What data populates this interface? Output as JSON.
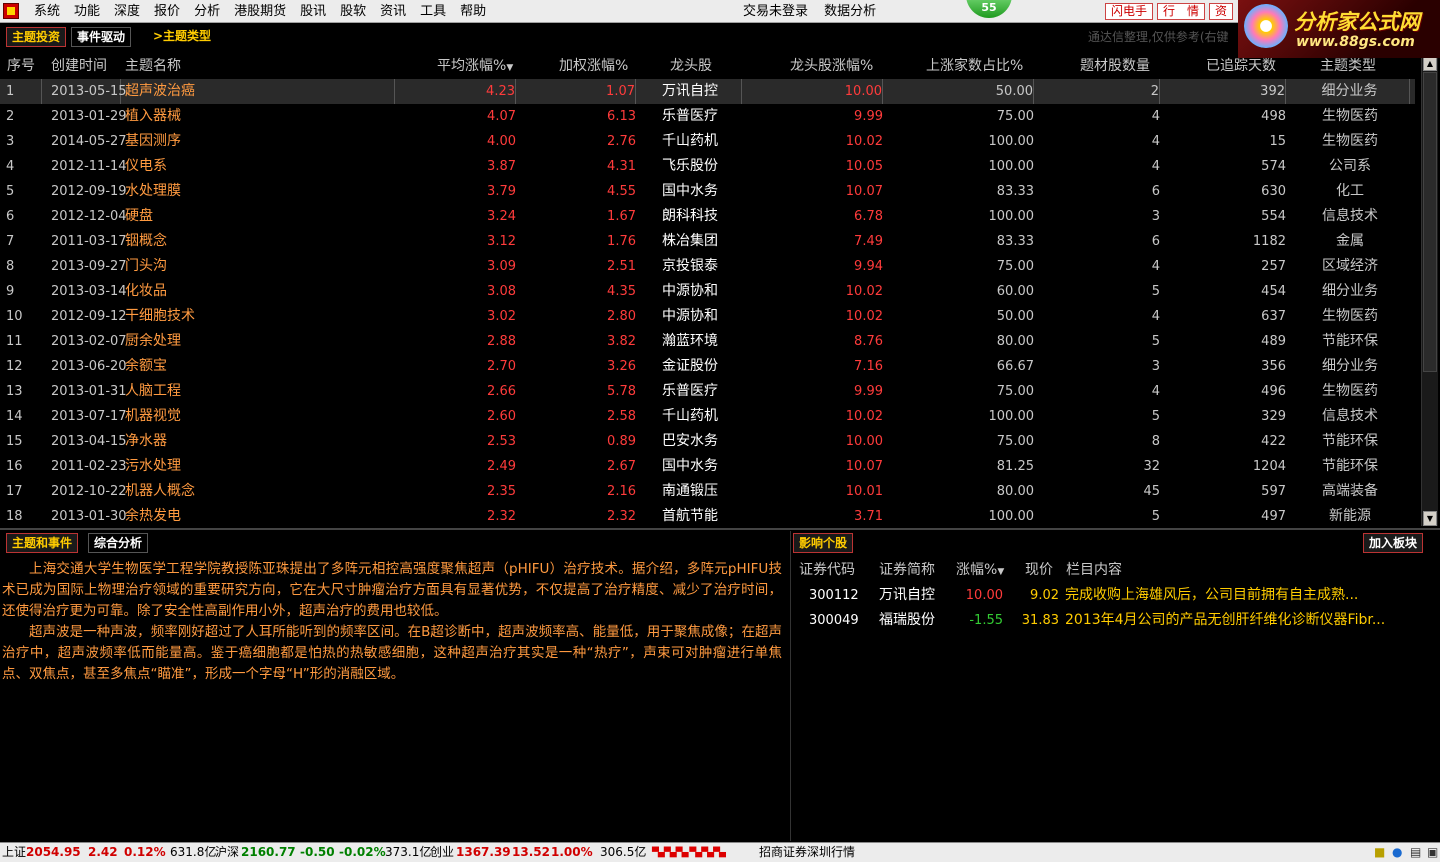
{
  "menu": [
    "系统",
    "功能",
    "深度",
    "报价",
    "分析",
    "港股期货",
    "股讯",
    "股软",
    "资讯",
    "工具",
    "帮助"
  ],
  "menubar": {
    "login": "交易未登录",
    "data": "数据分析",
    "badge": "55",
    "buttons": [
      "闪电手",
      "行　情",
      "资"
    ]
  },
  "brand": {
    "title": "分析家公式网",
    "url": "www.88gs.com"
  },
  "tabs": {
    "theme": "主题投资",
    "event": "事件驱动",
    "type": ">主题类型",
    "hint": "通达信整理,仅供参考(右键"
  },
  "headers": {
    "seq": "序号",
    "date": "创建时间",
    "name": "主题名称",
    "avg": "平均涨幅%",
    "wt": "加权涨幅%",
    "lead": "龙头股",
    "lchg": "龙头股涨幅%",
    "ratio": "上涨家数占比%",
    "cnt": "题材股数量",
    "days": "已追踪天数",
    "type": "主题类型"
  },
  "rows": [
    {
      "seq": "1",
      "date": "2013-05-15",
      "name": "超声波治癌",
      "avg": "4.23",
      "wt": "1.07",
      "lead": "万讯自控",
      "lchg": "10.00",
      "ratio": "50.00",
      "cnt": "2",
      "days": "392",
      "type": "细分业务"
    },
    {
      "seq": "2",
      "date": "2013-01-29",
      "name": "植入器械",
      "avg": "4.07",
      "wt": "6.13",
      "lead": "乐普医疗",
      "lchg": "9.99",
      "ratio": "75.00",
      "cnt": "4",
      "days": "498",
      "type": "生物医药"
    },
    {
      "seq": "3",
      "date": "2014-05-27",
      "name": "基因测序",
      "avg": "4.00",
      "wt": "2.76",
      "lead": "千山药机",
      "lchg": "10.02",
      "ratio": "100.00",
      "cnt": "4",
      "days": "15",
      "type": "生物医药"
    },
    {
      "seq": "4",
      "date": "2012-11-14",
      "name": "仪电系",
      "avg": "3.87",
      "wt": "4.31",
      "lead": "飞乐股份",
      "lchg": "10.05",
      "ratio": "100.00",
      "cnt": "4",
      "days": "574",
      "type": "公司系"
    },
    {
      "seq": "5",
      "date": "2012-09-19",
      "name": "水处理膜",
      "avg": "3.79",
      "wt": "4.55",
      "lead": "国中水务",
      "lchg": "10.07",
      "ratio": "83.33",
      "cnt": "6",
      "days": "630",
      "type": "化工"
    },
    {
      "seq": "6",
      "date": "2012-12-04",
      "name": "硬盘",
      "avg": "3.24",
      "wt": "1.67",
      "lead": "朗科科技",
      "lchg": "6.78",
      "ratio": "100.00",
      "cnt": "3",
      "days": "554",
      "type": "信息技术"
    },
    {
      "seq": "7",
      "date": "2011-03-17",
      "name": "铟概念",
      "avg": "3.12",
      "wt": "1.76",
      "lead": "株冶集团",
      "lchg": "7.49",
      "ratio": "83.33",
      "cnt": "6",
      "days": "1182",
      "type": "金属"
    },
    {
      "seq": "8",
      "date": "2013-09-27",
      "name": "门头沟",
      "avg": "3.09",
      "wt": "2.51",
      "lead": "京投银泰",
      "lchg": "9.94",
      "ratio": "75.00",
      "cnt": "4",
      "days": "257",
      "type": "区域经济"
    },
    {
      "seq": "9",
      "date": "2013-03-14",
      "name": "化妆品",
      "avg": "3.08",
      "wt": "4.35",
      "lead": "中源协和",
      "lchg": "10.02",
      "ratio": "60.00",
      "cnt": "5",
      "days": "454",
      "type": "细分业务"
    },
    {
      "seq": "10",
      "date": "2012-09-12",
      "name": "干细胞技术",
      "avg": "3.02",
      "wt": "2.80",
      "lead": "中源协和",
      "lchg": "10.02",
      "ratio": "50.00",
      "cnt": "4",
      "days": "637",
      "type": "生物医药"
    },
    {
      "seq": "11",
      "date": "2013-02-07",
      "name": "厨余处理",
      "avg": "2.88",
      "wt": "3.82",
      "lead": "瀚蓝环境",
      "lchg": "8.76",
      "ratio": "80.00",
      "cnt": "5",
      "days": "489",
      "type": "节能环保"
    },
    {
      "seq": "12",
      "date": "2013-06-20",
      "name": "余额宝",
      "avg": "2.70",
      "wt": "3.26",
      "lead": "金证股份",
      "lchg": "7.16",
      "ratio": "66.67",
      "cnt": "3",
      "days": "356",
      "type": "细分业务"
    },
    {
      "seq": "13",
      "date": "2013-01-31",
      "name": "人脑工程",
      "avg": "2.66",
      "wt": "5.78",
      "lead": "乐普医疗",
      "lchg": "9.99",
      "ratio": "75.00",
      "cnt": "4",
      "days": "496",
      "type": "生物医药"
    },
    {
      "seq": "14",
      "date": "2013-07-17",
      "name": "机器视觉",
      "avg": "2.60",
      "wt": "2.58",
      "lead": "千山药机",
      "lchg": "10.02",
      "ratio": "100.00",
      "cnt": "5",
      "days": "329",
      "type": "信息技术"
    },
    {
      "seq": "15",
      "date": "2013-04-15",
      "name": "净水器",
      "avg": "2.53",
      "wt": "0.89",
      "lead": "巴安水务",
      "lchg": "10.00",
      "ratio": "75.00",
      "cnt": "8",
      "days": "422",
      "type": "节能环保"
    },
    {
      "seq": "16",
      "date": "2011-02-23",
      "name": "污水处理",
      "avg": "2.49",
      "wt": "2.67",
      "lead": "国中水务",
      "lchg": "10.07",
      "ratio": "81.25",
      "cnt": "32",
      "days": "1204",
      "type": "节能环保"
    },
    {
      "seq": "17",
      "date": "2012-10-22",
      "name": "机器人概念",
      "avg": "2.35",
      "wt": "2.16",
      "lead": "南通锻压",
      "lchg": "10.01",
      "ratio": "80.00",
      "cnt": "45",
      "days": "597",
      "type": "高端装备"
    },
    {
      "seq": "18",
      "date": "2013-01-30",
      "name": "余热发电",
      "avg": "2.32",
      "wt": "2.32",
      "lead": "首航节能",
      "lchg": "3.71",
      "ratio": "100.00",
      "cnt": "5",
      "days": "497",
      "type": "新能源"
    }
  ],
  "bottom_tabs": {
    "theme_event": "主题和事件",
    "analysis": "综合分析",
    "influence": "影响个股",
    "add": "加入板块"
  },
  "article": [
    "上海交通大学生物医学工程学院教授陈亚珠提出了多阵元相控高强度聚焦超声（pHIFU）治疗技术。据介绍，多阵元pHIFU技术已成为国际上物理治疗领域的重要研究方向，它在大尺寸肿瘤治疗方面具有显著优势，不仅提高了治疗精度、减少了治疗时间，还使得治疗更为可靠。除了安全性高副作用小外，超声治疗的费用也较低。",
    "超声波是一种声波，频率刚好超过了人耳所能听到的频率区间。在B超诊断中，超声波频率高、能量低，用于聚焦成像；在超声治疗中，超声波频率低而能量高。鉴于癌细胞都是怕热的热敏感细胞，这种超声治疗其实是一种“热疗”，声束可对肿瘤进行单焦点、双焦点，甚至多焦点“瞄准”，形成一个字母“H”形的消融区域。"
  ],
  "stock_headers": {
    "code": "证券代码",
    "name": "证券简称",
    "chg": "涨幅%",
    "price": "现价",
    "content": "栏目内容"
  },
  "stocks": [
    {
      "code": "300112",
      "name": "万讯自控",
      "chg": "10.00",
      "price": "9.02",
      "content": "完成收购上海雄风后，公司目前拥有自主成熟..."
    },
    {
      "code": "300049",
      "name": "福瑞股份",
      "chg": "-1.55",
      "price": "31.83",
      "content": "2013年4月公司的产品无创肝纤维化诊断仪器Fibr..."
    }
  ],
  "status": {
    "sh_label": "上证",
    "sh_val": "2054.95",
    "sh_chg": "2.42",
    "sh_pct": "0.12%",
    "sh_amt": "631.8亿",
    "hs_label": "沪深",
    "hs_val": "2160.77",
    "hs_chg": "-0.50",
    "hs_pct": "-0.02%",
    "hs_amt": "373.1亿",
    "cy_label": "创业",
    "cy_val": "1367.39",
    "cy_chg": "13.52",
    "cy_pct": "1.00%",
    "cy_amt": "306.5亿",
    "broker": "招商证券深圳行情"
  }
}
